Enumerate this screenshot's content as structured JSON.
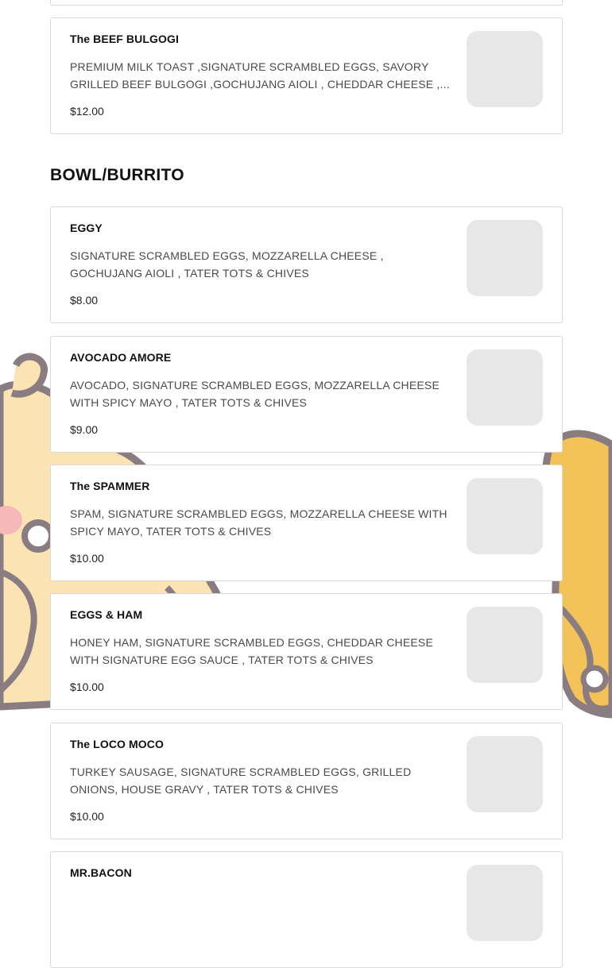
{
  "menu": {
    "top_items": [
      {
        "name": "The BEEF BULGOGI",
        "description": "PREMIUM MILK TOAST ,SIGNATURE SCRAMBLED EGGS, SAVORY GRILLED BEEF BULGOGI ,GOCHUJANG AIOLI , CHEDDAR CHEESE ,...",
        "price": "$12.00"
      }
    ],
    "section": {
      "title": "BOWL/BURRITO",
      "items": [
        {
          "name": "EGGY",
          "description": "SIGNATURE SCRAMBLED EGGS, MOZZARELLA CHEESE , GOCHUJANG AIOLI , TATER TOTS & CHIVES",
          "price": "$8.00"
        },
        {
          "name": "AVOCADO AMORE",
          "description": "AVOCADO, SIGNATURE SCRAMBLED EGGS, MOZZARELLA CHEESE WITH SPICY MAYO , TATER TOTS & CHIVES",
          "price": "$9.00"
        },
        {
          "name": "The SPAMMER",
          "description": "SPAM, SIGNATURE SCRAMBLED EGGS, MOZZARELLA CHEESE WITH SPICY MAYO, TATER TOTS & CHIVES",
          "price": "$10.00"
        },
        {
          "name": "EGGS & HAM",
          "description": "HONEY HAM, SIGNATURE SCRAMBLED EGGS, CHEDDAR CHEESE WITH SIGNATURE EGG SAUCE , TATER TOTS & CHIVES",
          "price": "$10.00"
        },
        {
          "name": "The LOCO MOCO",
          "description": "TURKEY SAUSAGE, SIGNATURE SCRAMBLED EGGS, GRILLED ONIONS, HOUSE GRAVY , TATER TOTS & CHIVES",
          "price": "$10.00"
        },
        {
          "name": "MR.BACON",
          "description": "",
          "price": ""
        }
      ]
    }
  },
  "colors": {
    "card_border": "#d9d9d9",
    "thumb_placeholder": "#e7e7e7",
    "text_primary": "#111111",
    "text_secondary": "#4a4a4a",
    "bg_character_fill": "#fbe3b4",
    "bg_character_outline": "#8a7d82",
    "bg_character_cheek": "#f6b8b8",
    "bg_accent": "#f3c35a"
  },
  "icons": {
    "background": "cartoon-egg-character-illustration",
    "thumbnail": "menu-item-image-placeholder"
  }
}
